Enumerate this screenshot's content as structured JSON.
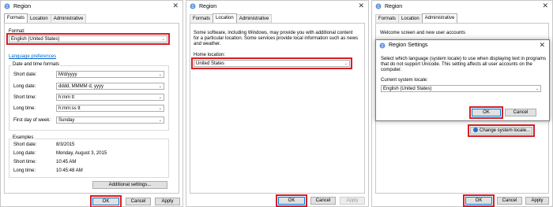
{
  "window_title": "Region",
  "close_glyph": "✕",
  "chevron": "⌄",
  "tabs": {
    "formats": "Formats",
    "location": "Location",
    "administrative": "Administrative"
  },
  "formats": {
    "format_label": "Format:",
    "format_value": "English (United States)",
    "language_link": "Language preferences",
    "dt_group": "Date and time formats",
    "rows": [
      {
        "label": "Short date:",
        "value": "M/d/yyyy"
      },
      {
        "label": "Long date:",
        "value": "dddd, MMMM d, yyyy"
      },
      {
        "label": "Short time:",
        "value": "h:mm tt"
      },
      {
        "label": "Long time:",
        "value": "h:mm:ss tt"
      },
      {
        "label": "First day of week:",
        "value": "Sunday"
      }
    ],
    "examples_title": "Examples",
    "examples": [
      {
        "label": "Short date:",
        "value": "8/3/2015"
      },
      {
        "label": "Long date:",
        "value": "Monday, August 3, 2015"
      },
      {
        "label": "Short time:",
        "value": "10:45 AM"
      },
      {
        "label": "Long time:",
        "value": "10:45:48 AM"
      }
    ],
    "additional_settings": "Additional settings..."
  },
  "location": {
    "description_lines": [
      "Some software, including Windows, may provide you with additional content",
      "for a particular location. Some services provide local information such as news",
      "and weather."
    ],
    "home_label": "Home location:",
    "home_value": "United States"
  },
  "administrative": {
    "welcome_title": "Welcome screen and new user accounts",
    "change_locale": "Change system locale..."
  },
  "dialog": {
    "title": "Region Settings",
    "description_lines": [
      "Select which language (system locale) to use when displaying text in programs",
      "that do not support Unicode. This setting affects all user accounts on the",
      "computer."
    ],
    "current_label": "Current system locale:",
    "current_value": "English (United States)",
    "ok": "OK",
    "cancel": "Cancel"
  },
  "buttons": {
    "ok": "OK",
    "cancel": "Cancel",
    "apply": "Apply"
  },
  "colors": {
    "highlight": "#d61f26",
    "link": "#0066cc"
  }
}
